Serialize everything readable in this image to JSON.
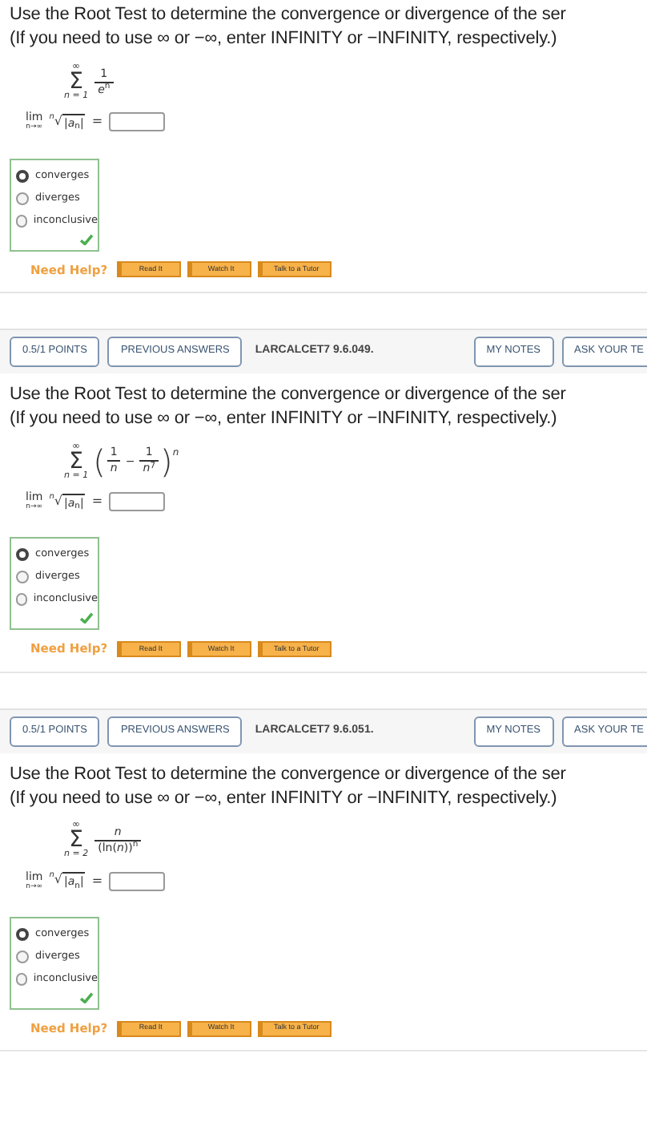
{
  "questions": [
    {
      "prompt": [
        "Use the Root Test to determine the convergence or divergence of the ser",
        "(If you need to use ∞ or −∞, enter INFINITY or −INFINITY, respectively.)"
      ],
      "series": {
        "symbol": "Σ",
        "upper": "∞",
        "lower": "n = 1",
        "body": [
          {
            "kind": "frac",
            "num": "1",
            "den": "*e*$^{n}$"
          }
        ]
      },
      "limit": {
        "word": "lim",
        "under": "n→∞",
        "index": "n",
        "radical": "√",
        "radicand": "|*a*$_{n}$|",
        "equals": "="
      },
      "options": [
        {
          "label": "converges",
          "selected": true
        },
        {
          "label": "diverges",
          "selected": false
        },
        {
          "label": "inconclusive",
          "selected": false
        }
      ],
      "correct": true,
      "help": {
        "label": "Need Help?",
        "buttons": [
          "Read It",
          "Watch It",
          "Talk to a Tutor"
        ]
      }
    },
    {
      "header": {
        "points": "0.5/1 POINTS",
        "previous": "PREVIOUS ANSWERS",
        "code": "LARCALCET7 9.6.049.",
        "notes": "MY NOTES",
        "ask": "ASK YOUR TE"
      },
      "prompt": [
        "Use the Root Test to determine the convergence or divergence of the ser",
        "(If you need to use ∞ or −∞, enter INFINITY or −INFINITY, respectively.)"
      ],
      "series": {
        "symbol": "Σ",
        "upper": "∞",
        "lower": "n = 1",
        "body": [
          {
            "kind": "paren",
            "text": "("
          },
          {
            "kind": "frac",
            "num": "1",
            "den": "*n*"
          },
          {
            "kind": "op",
            "text": "−"
          },
          {
            "kind": "frac",
            "num": "1",
            "den": "*n*$^{7}$"
          },
          {
            "kind": "paren",
            "text": ")",
            "sup": "n"
          }
        ]
      },
      "limit": {
        "word": "lim",
        "under": "n→∞",
        "index": "n",
        "radical": "√",
        "radicand": "|*a*$_{n}$|",
        "equals": "="
      },
      "options": [
        {
          "label": "converges",
          "selected": true
        },
        {
          "label": "diverges",
          "selected": false
        },
        {
          "label": "inconclusive",
          "selected": false
        }
      ],
      "correct": true,
      "help": {
        "label": "Need Help?",
        "buttons": [
          "Read It",
          "Watch It",
          "Talk to a Tutor"
        ]
      }
    },
    {
      "header": {
        "points": "0.5/1 POINTS",
        "previous": "PREVIOUS ANSWERS",
        "code": "LARCALCET7 9.6.051.",
        "notes": "MY NOTES",
        "ask": "ASK YOUR TE"
      },
      "prompt": [
        "Use the Root Test to determine the convergence or divergence of the ser",
        "(If you need to use ∞ or −∞, enter INFINITY or −INFINITY, respectively.)"
      ],
      "series": {
        "symbol": "Σ",
        "upper": "∞",
        "lower": "n = 2",
        "body": [
          {
            "kind": "frac",
            "num": "*n*",
            "den": "(ln(*n*))$^{n}$"
          }
        ]
      },
      "limit": {
        "word": "lim",
        "under": "n→∞",
        "index": "n",
        "radical": "√",
        "radicand": "|*a*$_{n}$|",
        "equals": "="
      },
      "options": [
        {
          "label": "converges",
          "selected": true
        },
        {
          "label": "diverges",
          "selected": false
        },
        {
          "label": "inconclusive",
          "selected": false
        }
      ],
      "correct": true,
      "help": {
        "label": "Need Help?",
        "buttons": [
          "Read It",
          "Watch It",
          "Talk to a Tutor"
        ]
      }
    }
  ]
}
